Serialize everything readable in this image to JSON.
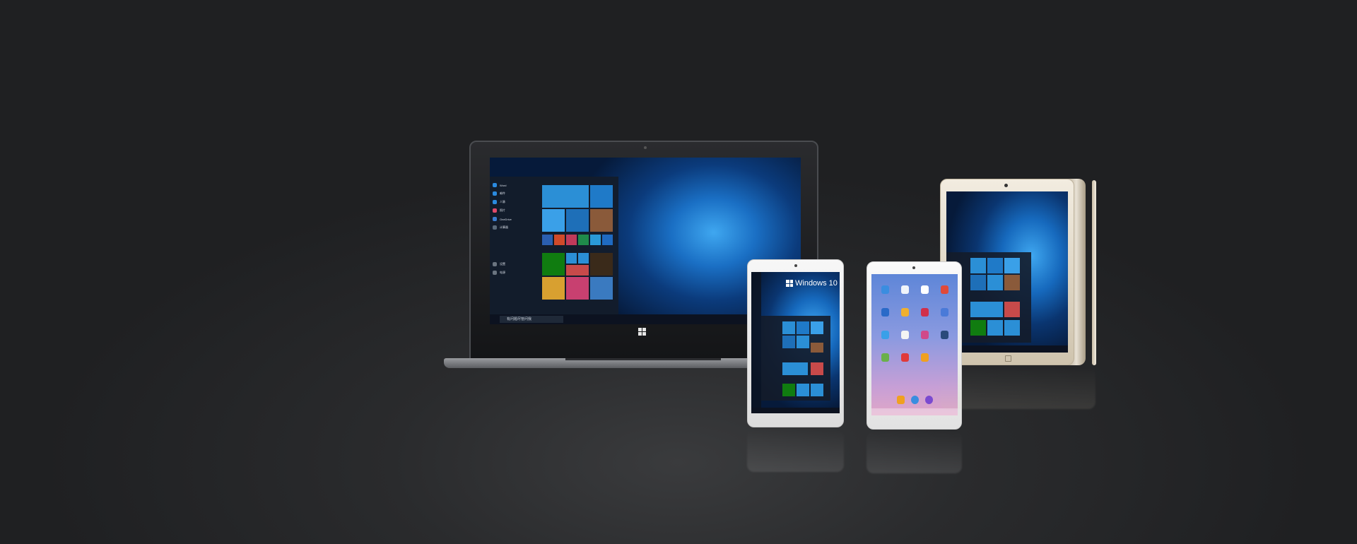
{
  "laptop": {
    "search_text": "有问题尽管问我",
    "start_items": [
      "Word",
      "邮件",
      "人脉",
      "照片",
      "OneDrive",
      "计算器",
      "设置",
      "电源"
    ]
  },
  "portrait_tablet": {
    "os_label": "Windows 10"
  },
  "colors": {
    "tile_blue": "#2b8fd6",
    "windows_bg": "#0b3b7c",
    "android_gradient_top": "#5e86d8",
    "android_gradient_bottom": "#e0a7c7",
    "gold_body": "#e8e1d4"
  },
  "icons": [
    "windows-logo-icon",
    "camera-icon",
    "home-button-icon"
  ]
}
